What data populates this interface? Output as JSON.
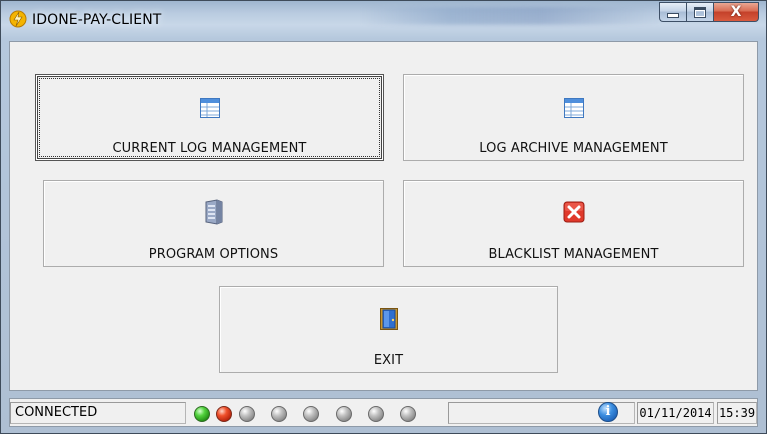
{
  "window": {
    "title": "IDONE-PAY-CLIENT",
    "controls": {
      "close_glyph": "X"
    }
  },
  "menu": {
    "current_log": {
      "label": "CURRENT LOG MANAGEMENT",
      "icon": "table-icon"
    },
    "log_archive": {
      "label": "LOG ARCHIVE MANAGEMENT",
      "icon": "table-icon"
    },
    "program_options": {
      "label": "PROGRAM OPTIONS",
      "icon": "server-icon"
    },
    "blacklist": {
      "label": "BLACKLIST MANAGEMENT",
      "icon": "red-x-icon"
    },
    "exit": {
      "label": "EXIT",
      "icon": "door-icon"
    }
  },
  "statusbar": {
    "status": "CONNECTED",
    "indicators": [
      "green",
      "red",
      "gray",
      "gray",
      "gray",
      "gray",
      "gray",
      "gray"
    ],
    "info_glyph": "i",
    "date": "01/11/2014",
    "time": "15:39"
  },
  "colors": {
    "led_green": "#52d23e",
    "led_red": "#f0512c",
    "led_gray": "#c2c2c2",
    "close_red": "#d86b52"
  }
}
